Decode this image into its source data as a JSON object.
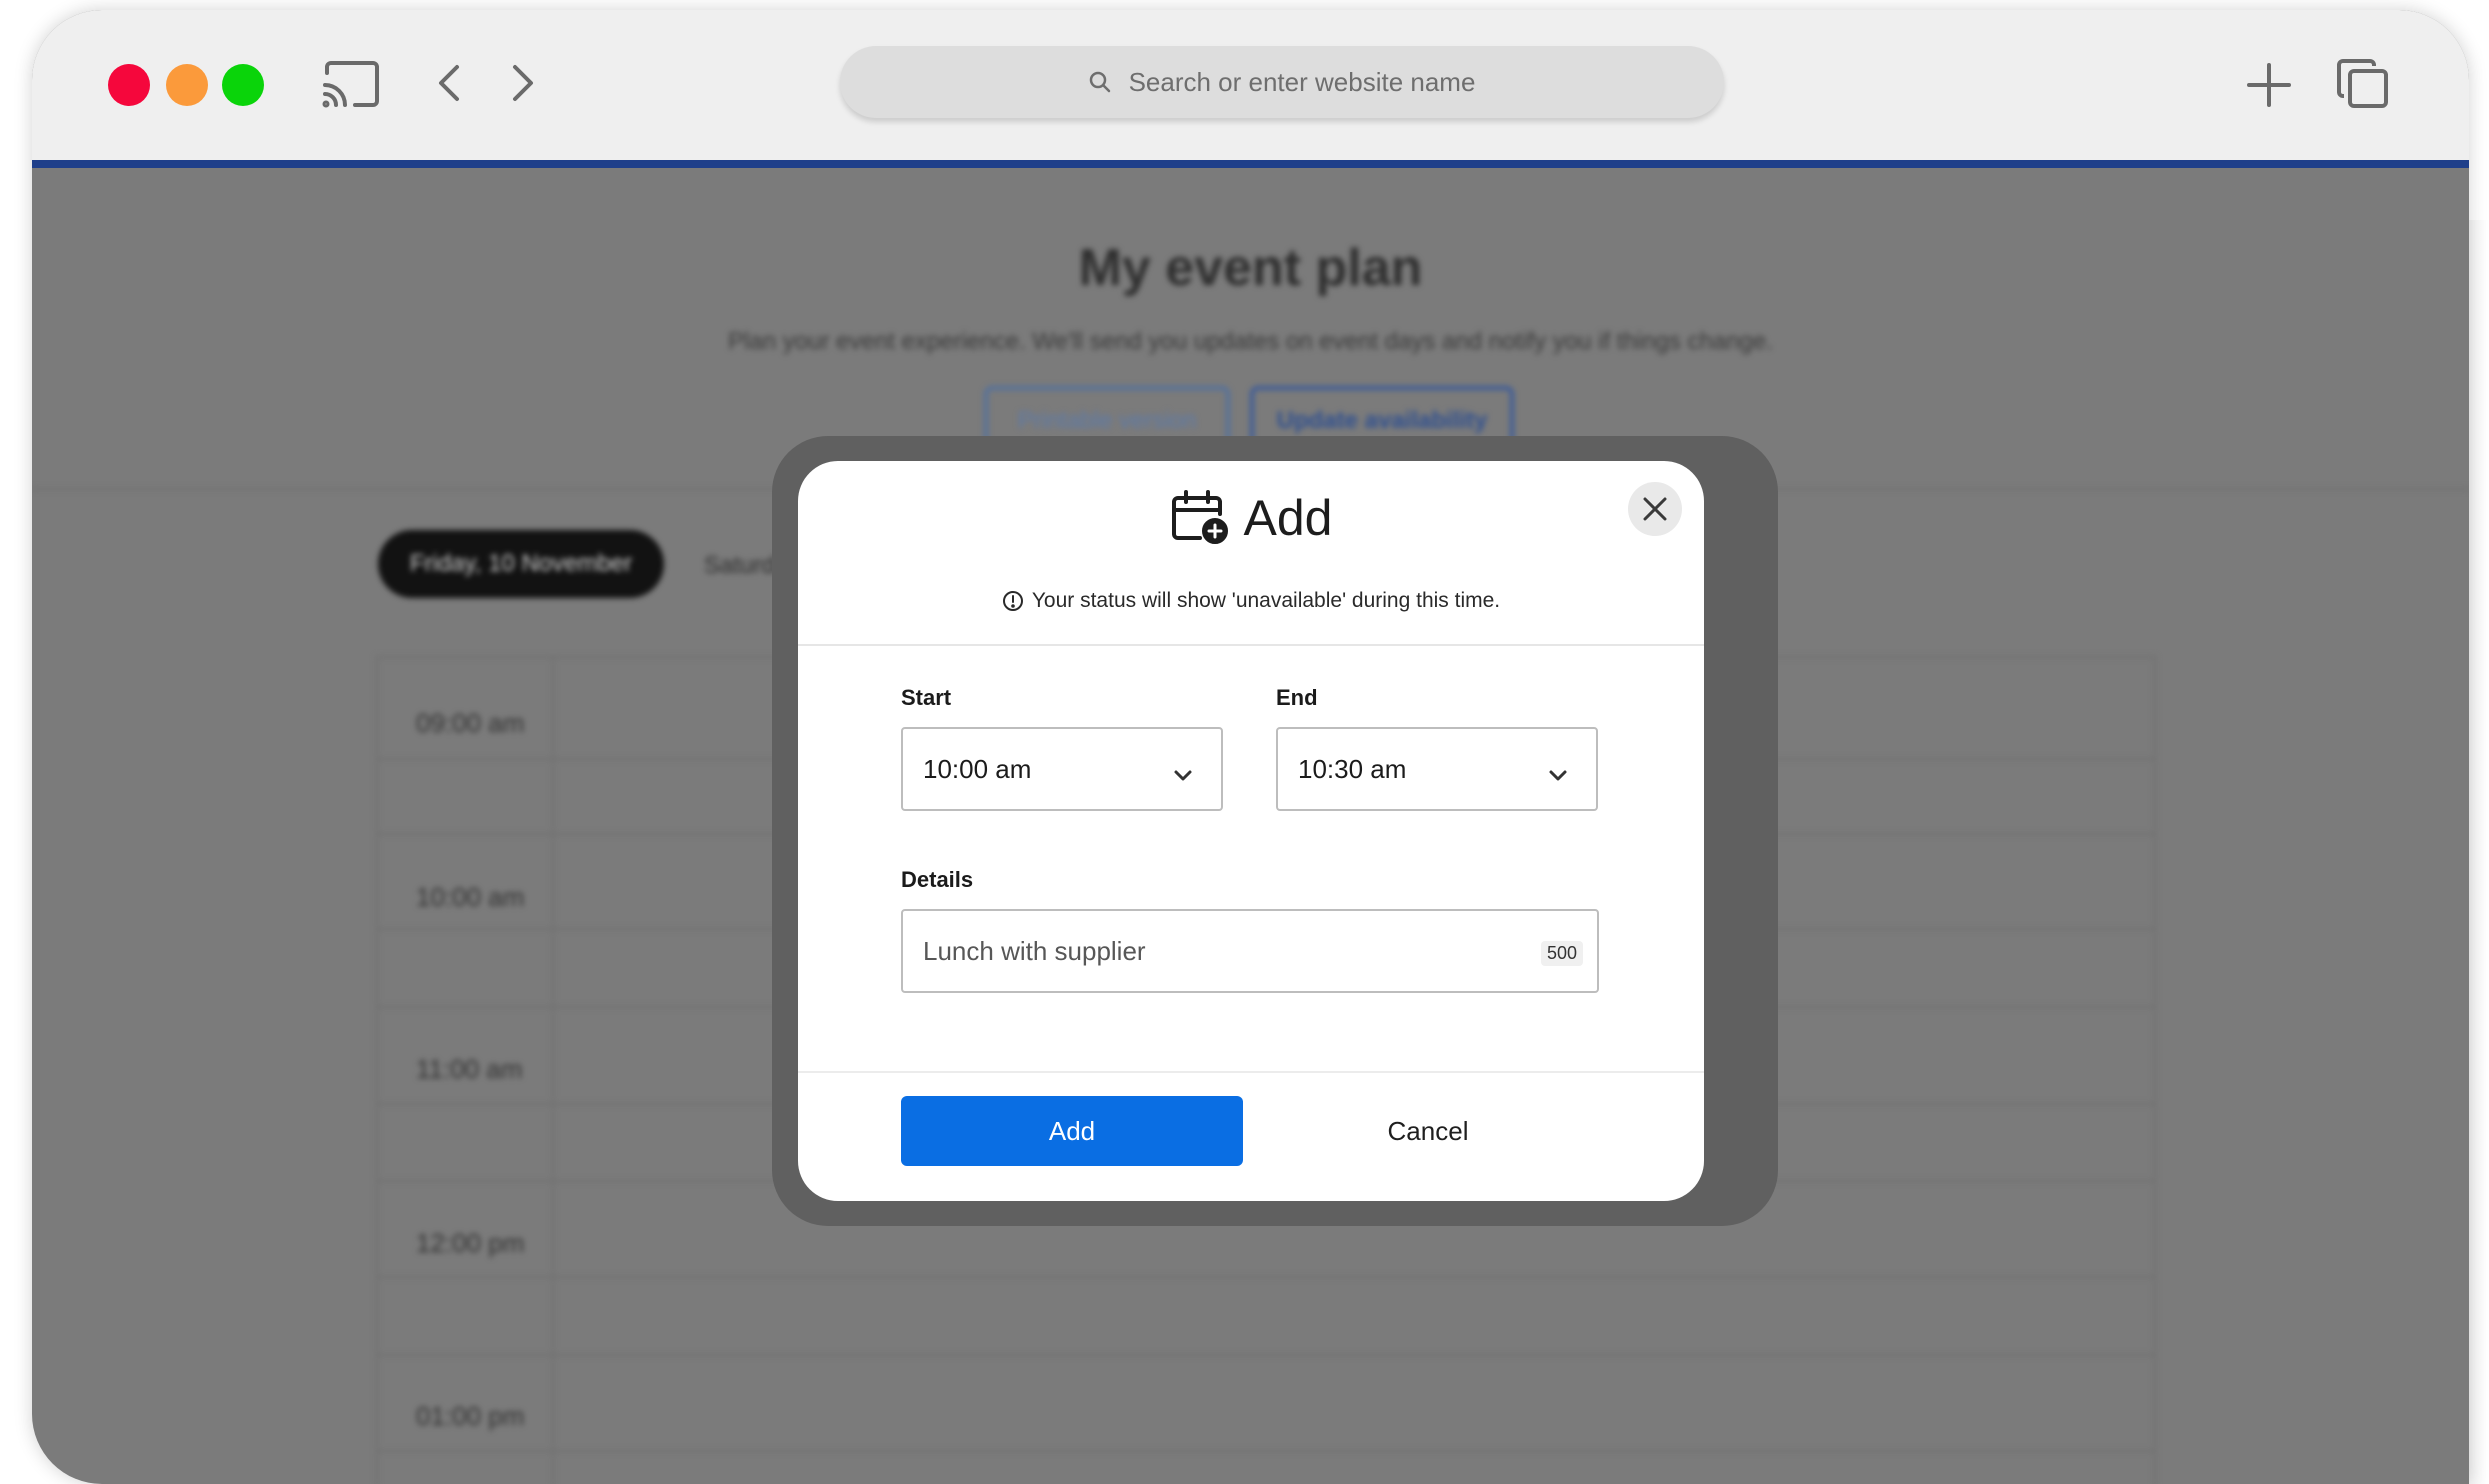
{
  "browser": {
    "address_placeholder": "Search or enter website name"
  },
  "background_page": {
    "title": "My event plan",
    "subtitle": "Plan your event experience. We'll send you updates on event days and notify you if things change.",
    "buttons": [
      "Printable version",
      "Update availability"
    ],
    "day_tabs": [
      "Friday, 10 November",
      "Saturday"
    ],
    "times": [
      "09:00 am",
      "10:00 am",
      "11:00 am",
      "12:00 pm",
      "01:00 pm"
    ]
  },
  "modal": {
    "title": "Add",
    "notice": "Your status will show 'unavailable' during this time.",
    "start_label": "Start",
    "start_value": "10:00 am",
    "end_label": "End",
    "end_value": "10:30 am",
    "details_label": "Details",
    "details_value": "Lunch with supplier",
    "char_counter": "500",
    "add_button": "Add",
    "cancel_button": "Cancel"
  },
  "colors": {
    "primary_button": "#0a6ee3",
    "accent_bar": "#1f3f8a",
    "traffic_red": "#f5073c",
    "traffic_orange": "#fb9a3b",
    "traffic_green": "#0ad40a"
  }
}
